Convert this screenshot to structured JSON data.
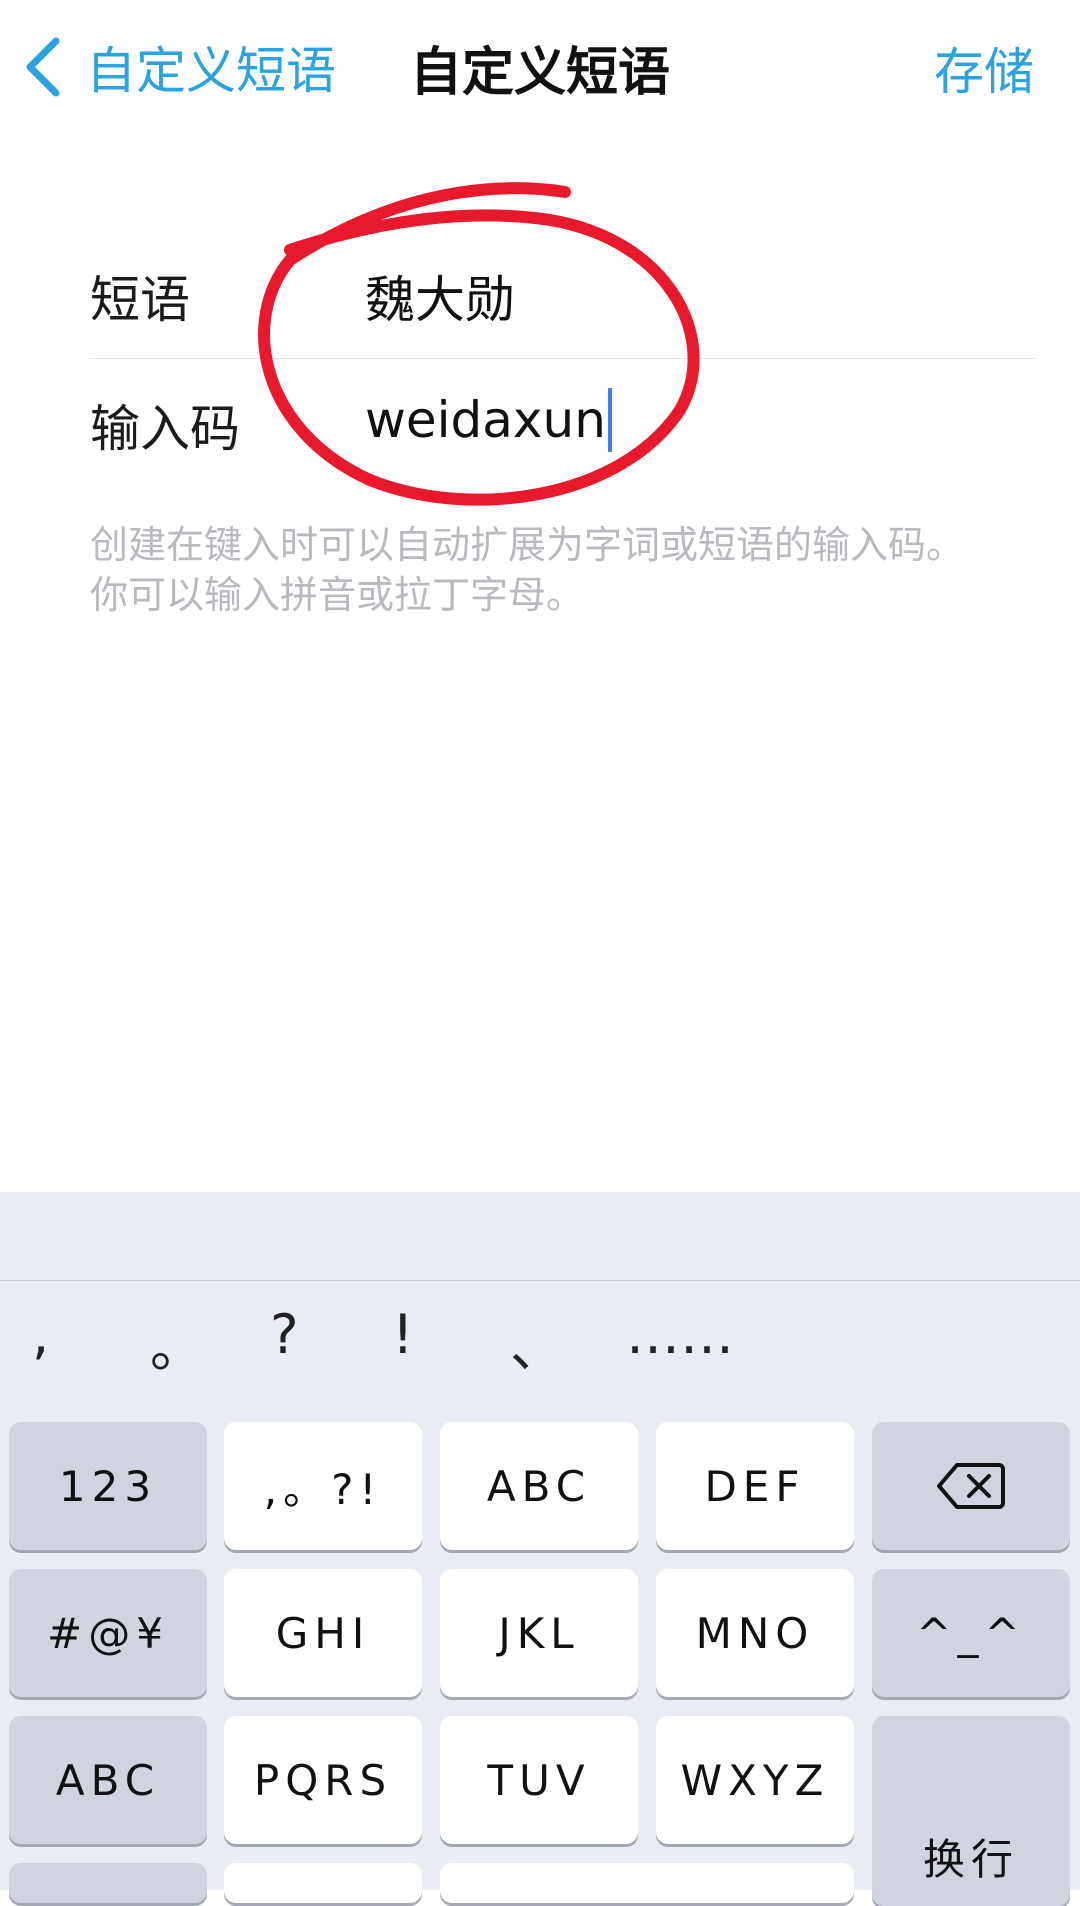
{
  "nav": {
    "back_label": "自定义短语",
    "title": "自定义短语",
    "save_label": "存储"
  },
  "form": {
    "phrase_label": "短语",
    "phrase_value": "魏大勋",
    "shortcut_label": "输入码",
    "shortcut_value": "weidaxun",
    "hint": "创建在键入时可以自动扩展为字词或短语的输入码。你可以输入拼音或拉丁字母。"
  },
  "annotation": {
    "color": "#e8192c",
    "shape": "hand-drawn circle"
  },
  "keyboard": {
    "punctuation": [
      ",",
      "。",
      "?",
      "!",
      "、",
      "……"
    ],
    "rows": [
      [
        "123",
        ",。?!",
        "ABC",
        "DEF",
        "delete"
      ],
      [
        "#@¥",
        "GHI",
        "JKL",
        "MNO",
        "^_^"
      ],
      [
        "ABC",
        "PQRS",
        "TUV",
        "WXYZ",
        "换行"
      ]
    ],
    "delete_icon": "backspace-icon"
  },
  "colors": {
    "accent": "#2aa3e0",
    "keyboard_bg": "#e9ecf3",
    "key_dark": "#cfd4de"
  }
}
